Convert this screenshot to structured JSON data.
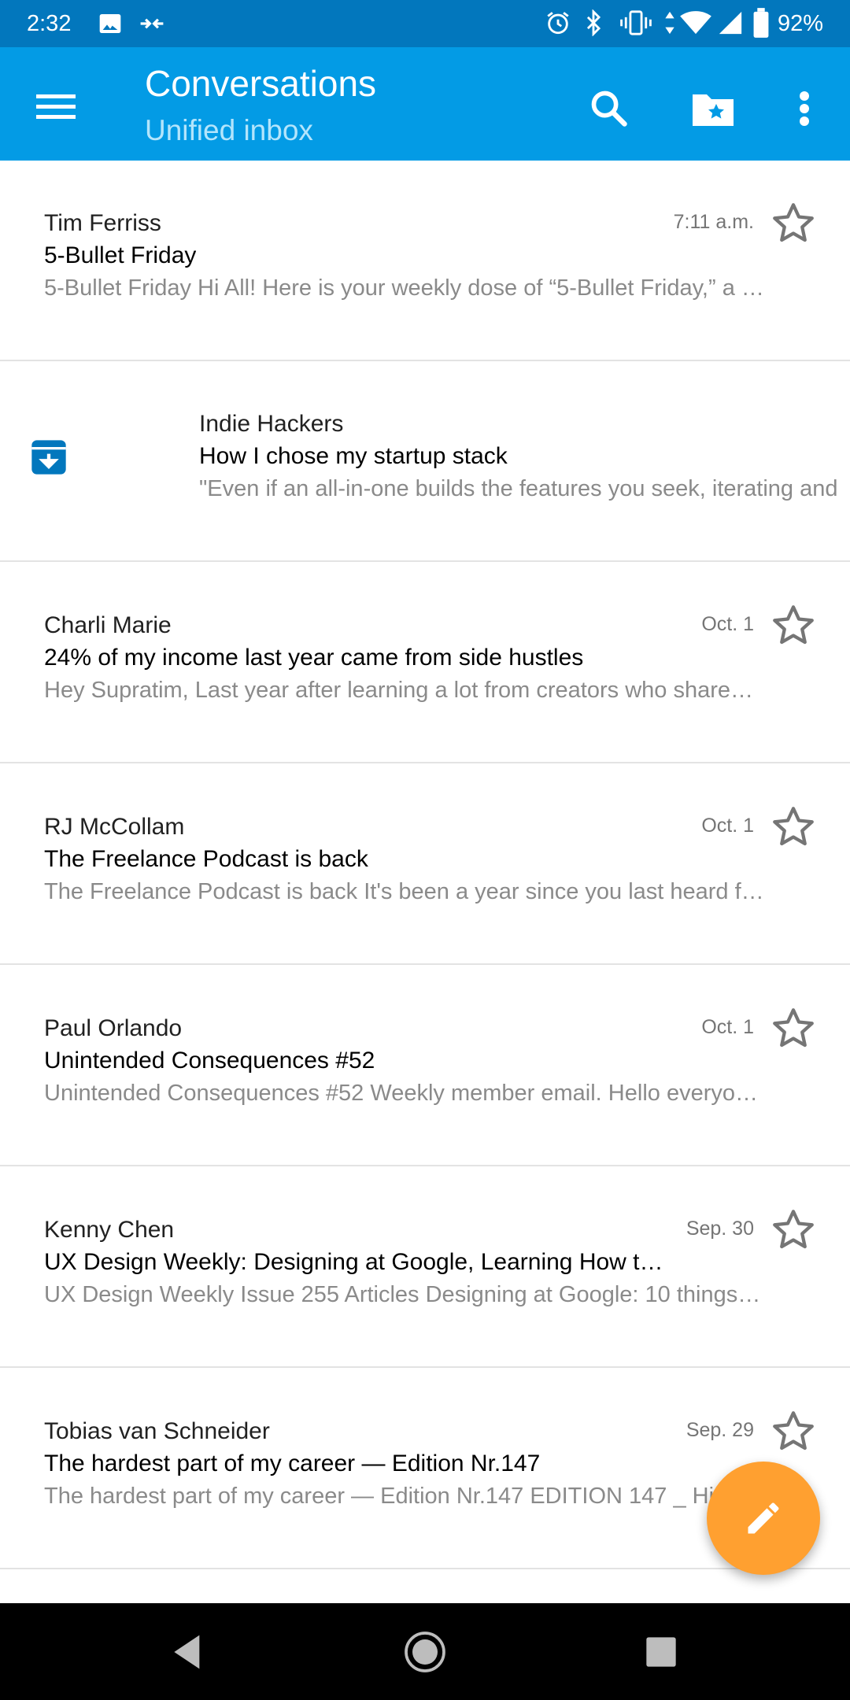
{
  "status_bar": {
    "time": "2:32",
    "battery": "92%",
    "icons_left": [
      "image-icon",
      "data-saver-icon"
    ],
    "icons_right": [
      "alarm-icon",
      "bluetooth-icon",
      "vibrate-icon",
      "data-transfer-icon",
      "wifi-icon",
      "cell-signal-icon",
      "battery-icon"
    ]
  },
  "app_bar": {
    "title": "Conversations",
    "subtitle": "Unified inbox",
    "color": "#039be5",
    "actions": [
      "search-icon",
      "starred-folder-icon",
      "overflow-menu-icon"
    ]
  },
  "messages": [
    {
      "sender": "Tim Ferriss",
      "subject": "5-Bullet Friday",
      "preview": "5-Bullet Friday Hi All! Here is your weekly dose of “5-Bullet Friday,” a l…",
      "date": "7:11 a.m.",
      "starred": false
    },
    {
      "sender": "Indie Hackers",
      "subject": "How I chose my startup stack",
      "preview": "\"Even if an all-in-one builds the features you seek, iterating and",
      "date": "",
      "starred": false,
      "swiped": true,
      "swipe_action_icon": "archive-icon"
    },
    {
      "sender": "Charli Marie",
      "subject": "24% of my income last year came from side hustles",
      "preview": "Hey Supratim, Last year after learning a lot from creators who share…",
      "date": "Oct. 1",
      "starred": false
    },
    {
      "sender": "RJ McCollam",
      "subject": "The Freelance Podcast is back",
      "preview": "The Freelance Podcast is back It's been a year since you last heard f…",
      "date": "Oct. 1",
      "starred": false
    },
    {
      "sender": "Paul Orlando",
      "subject": "Unintended Consequences #52",
      "preview": "Unintended Consequences #52 Weekly member email. Hello everyo…",
      "date": "Oct. 1",
      "starred": false
    },
    {
      "sender": "Kenny Chen",
      "subject": "UX Design Weekly: Designing at Google, Learning How t…",
      "preview": "UX Design Weekly Issue 255 Articles Designing at Google: 10 things…",
      "date": "Sep. 30",
      "starred": false
    },
    {
      "sender": "Tobias van Schneider",
      "subject": "The hardest part of my career — Edition Nr.147",
      "preview": "The hardest part of my career — Edition Nr.147 EDITION 147 _ Hi",
      "date": "Sep. 29",
      "starred": false
    }
  ],
  "fab": {
    "icon": "pencil-icon",
    "color": "#ffa030"
  },
  "nav_bar": [
    "back-icon",
    "home-icon",
    "recents-icon"
  ]
}
